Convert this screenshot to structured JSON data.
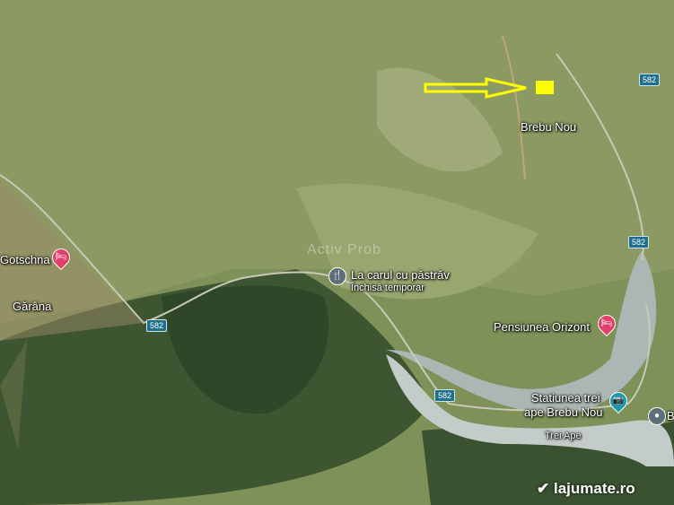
{
  "places": {
    "brebu_nou": "Brebu Nou",
    "gotschna": "Gotschna",
    "garana": "Gărâna",
    "restaurant": "La carul cu păstrăv",
    "restaurant_status": "Închisă temporar",
    "pensiunea": "Pensiunea Orizont",
    "statiunea_line1": "Statiunea trei",
    "statiunea_line2": "ape Brebu Nou",
    "trei_ape": "Trei Ape",
    "edge_label": "B"
  },
  "roads": {
    "r1": "582",
    "r2": "582",
    "r3": "582",
    "r4": "582"
  },
  "watermark": "Activ Prob",
  "logo": "lajumate.ro",
  "colors": {
    "arrow": "#ffff00",
    "marker": "#ffff00",
    "pin_red": "#e0406a",
    "pin_teal": "#1b9aa8",
    "pin_gray": "#5f6f7a"
  }
}
